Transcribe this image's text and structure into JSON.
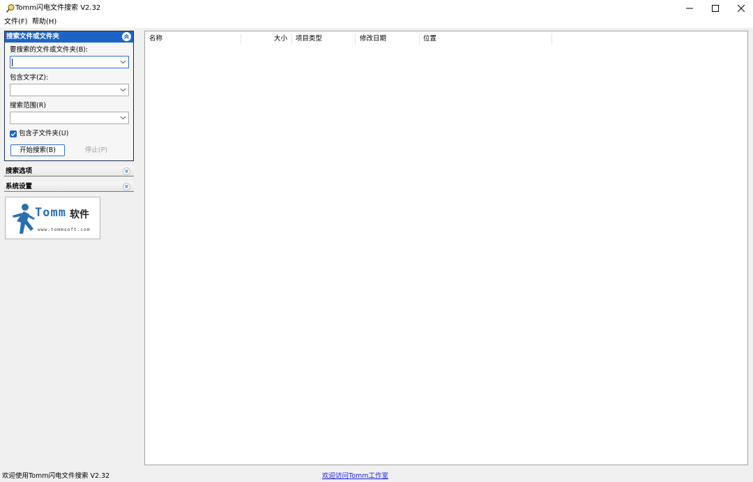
{
  "window": {
    "title": "Tomm闪电文件搜索 V2.32",
    "icons": {
      "app": "magnifier-icon",
      "minimize": "minimize-icon",
      "maximize": "maximize-icon",
      "close": "close-icon"
    }
  },
  "menu": {
    "items": [
      {
        "label": "文件(F)"
      },
      {
        "label": "帮助(H)"
      }
    ]
  },
  "search_panel": {
    "title": "搜索文件或文件夹",
    "name_label": "要搜索的文件或文件夹(B):",
    "name_value": "",
    "text_label": "包含文字(Z):",
    "text_value": "",
    "scope_label": "搜索范围(R)",
    "scope_value": "",
    "subfolders_label": "包含子文件夹(U)",
    "subfolders_checked": true,
    "start_label": "开始搜索(B)",
    "stop_label": "停止(P)"
  },
  "sections": [
    {
      "title": "搜索选项"
    },
    {
      "title": "系统设置"
    }
  ],
  "logo": {
    "brand": "Tomm",
    "tagline": "软件",
    "url": "www.tommsoft.com"
  },
  "list": {
    "columns": [
      {
        "label": "名称",
        "align": "left"
      },
      {
        "label": "大小",
        "align": "right"
      },
      {
        "label": "项目类型",
        "align": "left"
      },
      {
        "label": "修改日期",
        "align": "left"
      },
      {
        "label": "位置",
        "align": "left"
      }
    ],
    "rows": []
  },
  "status": {
    "text": "欢迎使用Tomm闪电文件搜索 V2.32",
    "link": "欢迎访问Tomm工作室"
  },
  "colors": {
    "accent": "#1e64c8",
    "focus": "#2e6fd9",
    "link": "#2020e0",
    "panel_bg": "#f0f0f0"
  }
}
